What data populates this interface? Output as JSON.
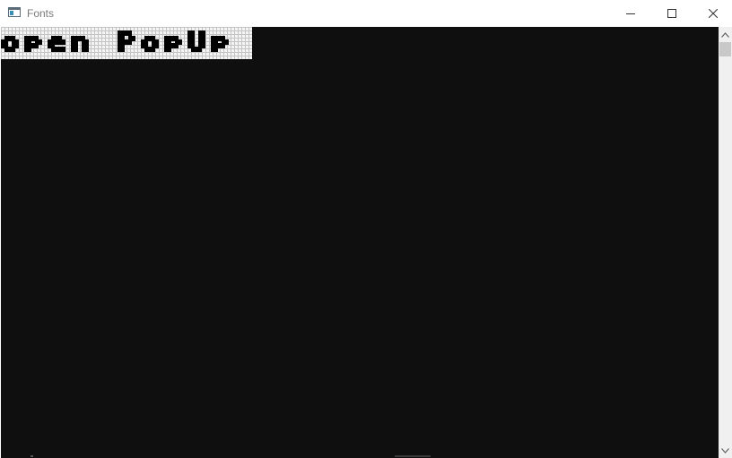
{
  "window": {
    "title": "Fonts",
    "controls": {
      "minimize": "minimize-icon",
      "maximize": "maximize-icon",
      "close": "close-icon"
    }
  },
  "content": {
    "background": "#0f0f0f",
    "popup_button": {
      "label": "open PopUp",
      "text_color": "#000000",
      "background": "#f4f4f4",
      "grid_color": "#c4c4c4"
    }
  },
  "scrollbar": {
    "up_icon": "chevron-up-icon",
    "down_icon": "chevron-down-icon"
  }
}
